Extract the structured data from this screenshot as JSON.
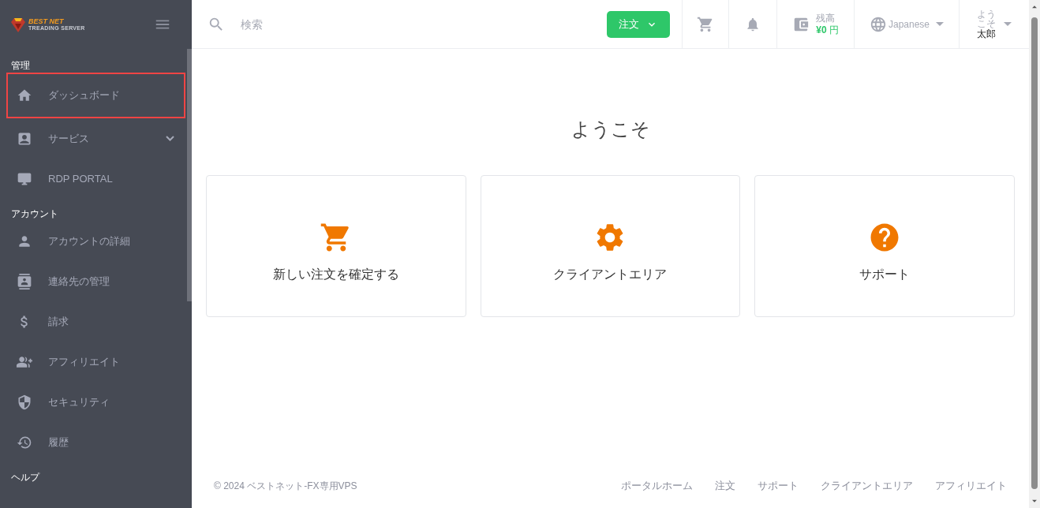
{
  "sidebar": {
    "logo": {
      "title": "BEST NET",
      "subtitle": "TREADING SERVER"
    },
    "sections": [
      {
        "heading": "管理",
        "items": [
          {
            "kind": "link",
            "label": "ダッシュボード",
            "highlighted": true
          },
          {
            "kind": "submenu",
            "label": "サービス",
            "expanded": false,
            "highlighted": false
          },
          {
            "kind": "link",
            "label": "RDP PORTAL",
            "highlighted": false
          }
        ]
      },
      {
        "heading": "アカウント",
        "items": [
          {
            "kind": "link",
            "label": "アカウントの詳細",
            "highlighted": false
          },
          {
            "kind": "link",
            "label": "連絡先の管理",
            "highlighted": false
          },
          {
            "kind": "link",
            "label": "請求",
            "highlighted": false
          },
          {
            "kind": "link",
            "label": "アフィリエイト",
            "highlighted": false
          },
          {
            "kind": "link",
            "label": "セキュリティ",
            "highlighted": false
          },
          {
            "kind": "link",
            "label": "履歴",
            "highlighted": false
          }
        ]
      },
      {
        "heading": "ヘルプ"
      }
    ]
  },
  "header": {
    "search": {
      "placeholder": "検索"
    },
    "order_button": "注文",
    "balance": {
      "label": "残高",
      "amount": "¥0",
      "currency": "円"
    },
    "language": "Japanese",
    "user": {
      "greeting": "ようこそ",
      "name": "太郎"
    }
  },
  "main": {
    "title": "ようこそ",
    "cards": [
      {
        "label": "新しい注文を確定する"
      },
      {
        "label": "クライアントエリア"
      },
      {
        "label": "サポート"
      }
    ]
  },
  "footer": {
    "copyright": "© 2024 ベストネット-FX専用VPS",
    "links": [
      "ポータルホーム",
      "注文",
      "サポート",
      "クライアントエリア",
      "アフィリエイト"
    ]
  }
}
